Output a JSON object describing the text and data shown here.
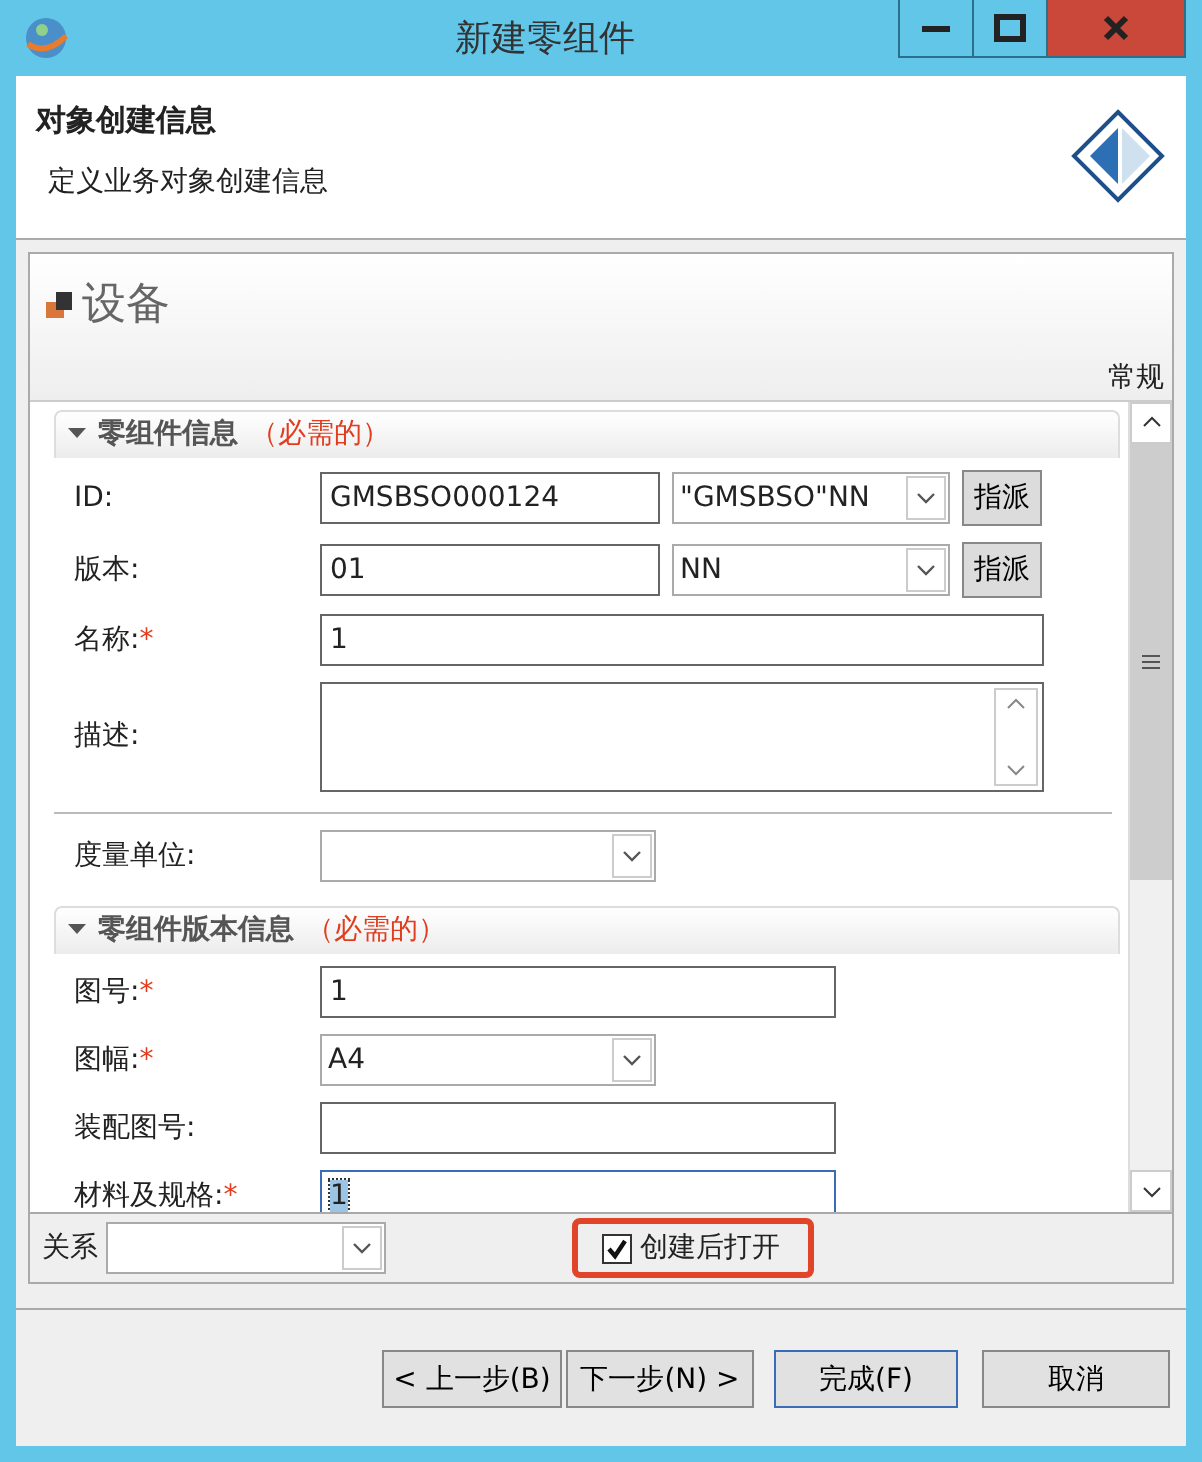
{
  "window": {
    "title": "新建零组件"
  },
  "header": {
    "title": "对象创建信息",
    "subtitle": "定义业务对象创建信息"
  },
  "object_type": {
    "label": "设备",
    "tab": "常规"
  },
  "sections": [
    {
      "title": "零组件信息",
      "note": "（必需的）",
      "expanded": true,
      "fields": [
        {
          "kind": "assign",
          "label": "ID:",
          "value": "GMSBSO000124",
          "pattern": "\"GMSBSO\"NN",
          "button": "指派"
        },
        {
          "kind": "assign",
          "label": "版本:",
          "value": "01",
          "pattern": "NN",
          "button": "指派"
        },
        {
          "kind": "text",
          "label": "名称:",
          "required_mark": "*",
          "value": "1"
        },
        {
          "kind": "textarea",
          "label": "描述:"
        },
        {
          "kind": "separator"
        },
        {
          "kind": "combo",
          "label": "度量单位:"
        }
      ]
    },
    {
      "title": "零组件版本信息",
      "note": "（必需的）",
      "expanded": true,
      "fields": [
        {
          "kind": "text",
          "label": "图号:",
          "required_mark": "*",
          "value": "1"
        },
        {
          "kind": "combo",
          "label": "图幅:",
          "required_mark": "*",
          "value": "A4"
        },
        {
          "kind": "text",
          "label": "装配图号:"
        },
        {
          "kind": "text",
          "label": "材料及规格:",
          "required_mark": "*",
          "value": "1",
          "focused": true
        }
      ]
    }
  ],
  "footer": {
    "relation_label": "关系",
    "open_after_create": {
      "label": "创建后打开",
      "checked": true,
      "highlighted": true
    }
  },
  "buttons": [
    {
      "label": "< 上一步(B)",
      "default": false
    },
    {
      "label": "下一步(N) >",
      "default": false
    },
    {
      "label": "完成(F)",
      "default": true
    },
    {
      "label": "取消",
      "default": false
    }
  ]
}
